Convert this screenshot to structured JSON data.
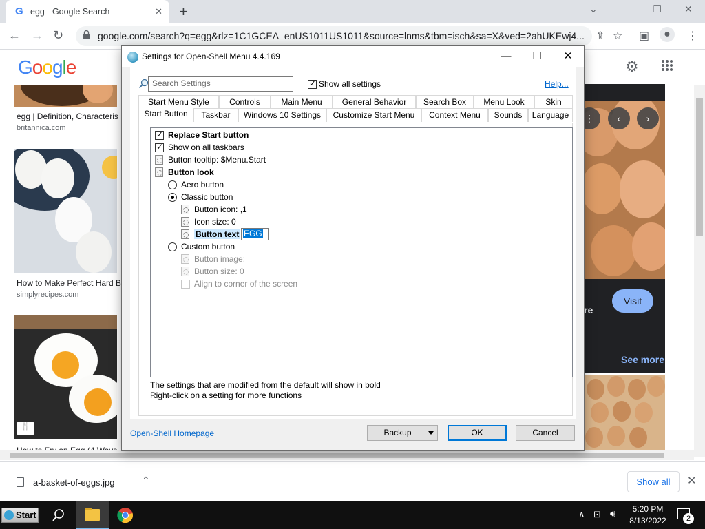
{
  "browser": {
    "tab_title": "egg - Google Search",
    "tab_favicon": "G",
    "new_tab": "+",
    "url": "google.com/search?q=egg&rlz=1C1GCEA_enUS1011US1011&source=lnms&tbm=isch&sa=X&ved=2ahUKEwj4...",
    "window_controls": [
      "⌄",
      "—",
      "❐",
      "✕"
    ]
  },
  "google": {
    "logo_letters": [
      "G",
      "o",
      "o",
      "g",
      "l",
      "e"
    ],
    "logo_colors": [
      "#4285f4",
      "#ea4335",
      "#fbbc05",
      "#4285f4",
      "#34a853",
      "#ea4335"
    ],
    "results": [
      {
        "title": "egg | Definition, Characteris",
        "source": "britannica.com"
      },
      {
        "title": "How to Make Perfect Hard B",
        "source": "simplyrecipes.com"
      },
      {
        "title": "How to Fry an Egg (4 Ways",
        "source": ""
      }
    ],
    "right_panel": {
      "visit_label": "Visit",
      "title_fragment": "re",
      "see_more": "See more"
    }
  },
  "downloads": {
    "file_name": "a-basket-of-eggs.jpg",
    "show_all": "Show all"
  },
  "taskbar": {
    "start_label": "Start",
    "time": "5:20 PM",
    "date": "8/13/2022",
    "notification_count": "2"
  },
  "dialog": {
    "title": "Settings for Open-Shell Menu 4.4.169",
    "search_placeholder": "Search Settings",
    "show_all_settings": "Show all settings",
    "help": "Help...",
    "tabs_row1": [
      "Start Menu Style",
      "Controls",
      "Main Menu",
      "General Behavior",
      "Search Box",
      "Menu Look",
      "Skin"
    ],
    "tabs_row2": [
      "Start Button",
      "Taskbar",
      "Windows 10 Settings",
      "Customize Start Menu",
      "Context Menu",
      "Sounds",
      "Language"
    ],
    "active_tab": "Start Button",
    "settings": {
      "replace_start": "Replace Start button",
      "show_all_taskbars": "Show on all taskbars",
      "button_tooltip": "Button tooltip: $Menu.Start",
      "button_look": "Button look",
      "aero_button": "Aero button",
      "classic_button": "Classic button",
      "button_icon": "Button icon: ,1",
      "icon_size": "Icon size: 0",
      "button_text_label": "Button text",
      "button_text_value": "EGG",
      "custom_button": "Custom button",
      "button_image": "Button image:",
      "button_size": "Button size: 0",
      "align_corner": "Align to corner of the screen"
    },
    "footnote1": "The settings that are modified from the default will show in bold",
    "footnote2": "Right-click on a setting for more functions",
    "homepage_link": "Open-Shell Homepage",
    "backup": "Backup",
    "ok": "OK",
    "cancel": "Cancel"
  }
}
